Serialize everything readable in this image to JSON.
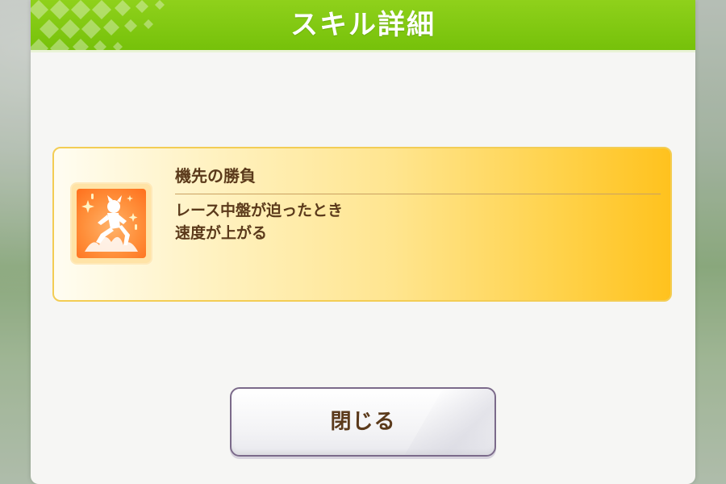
{
  "dialog": {
    "title": "スキル詳細"
  },
  "skill": {
    "name": "機先の勝負",
    "description_line1": "レース中盤が迫ったとき",
    "description_line2": "速度が上がる",
    "icon": "speed-up-runner-icon"
  },
  "buttons": {
    "close_label": "閉じる"
  },
  "colors": {
    "header_green": "#7cc412",
    "card_gold": "#ffc21e",
    "text_brown": "#5b3a1b",
    "icon_orange": "#ff8f3a"
  }
}
